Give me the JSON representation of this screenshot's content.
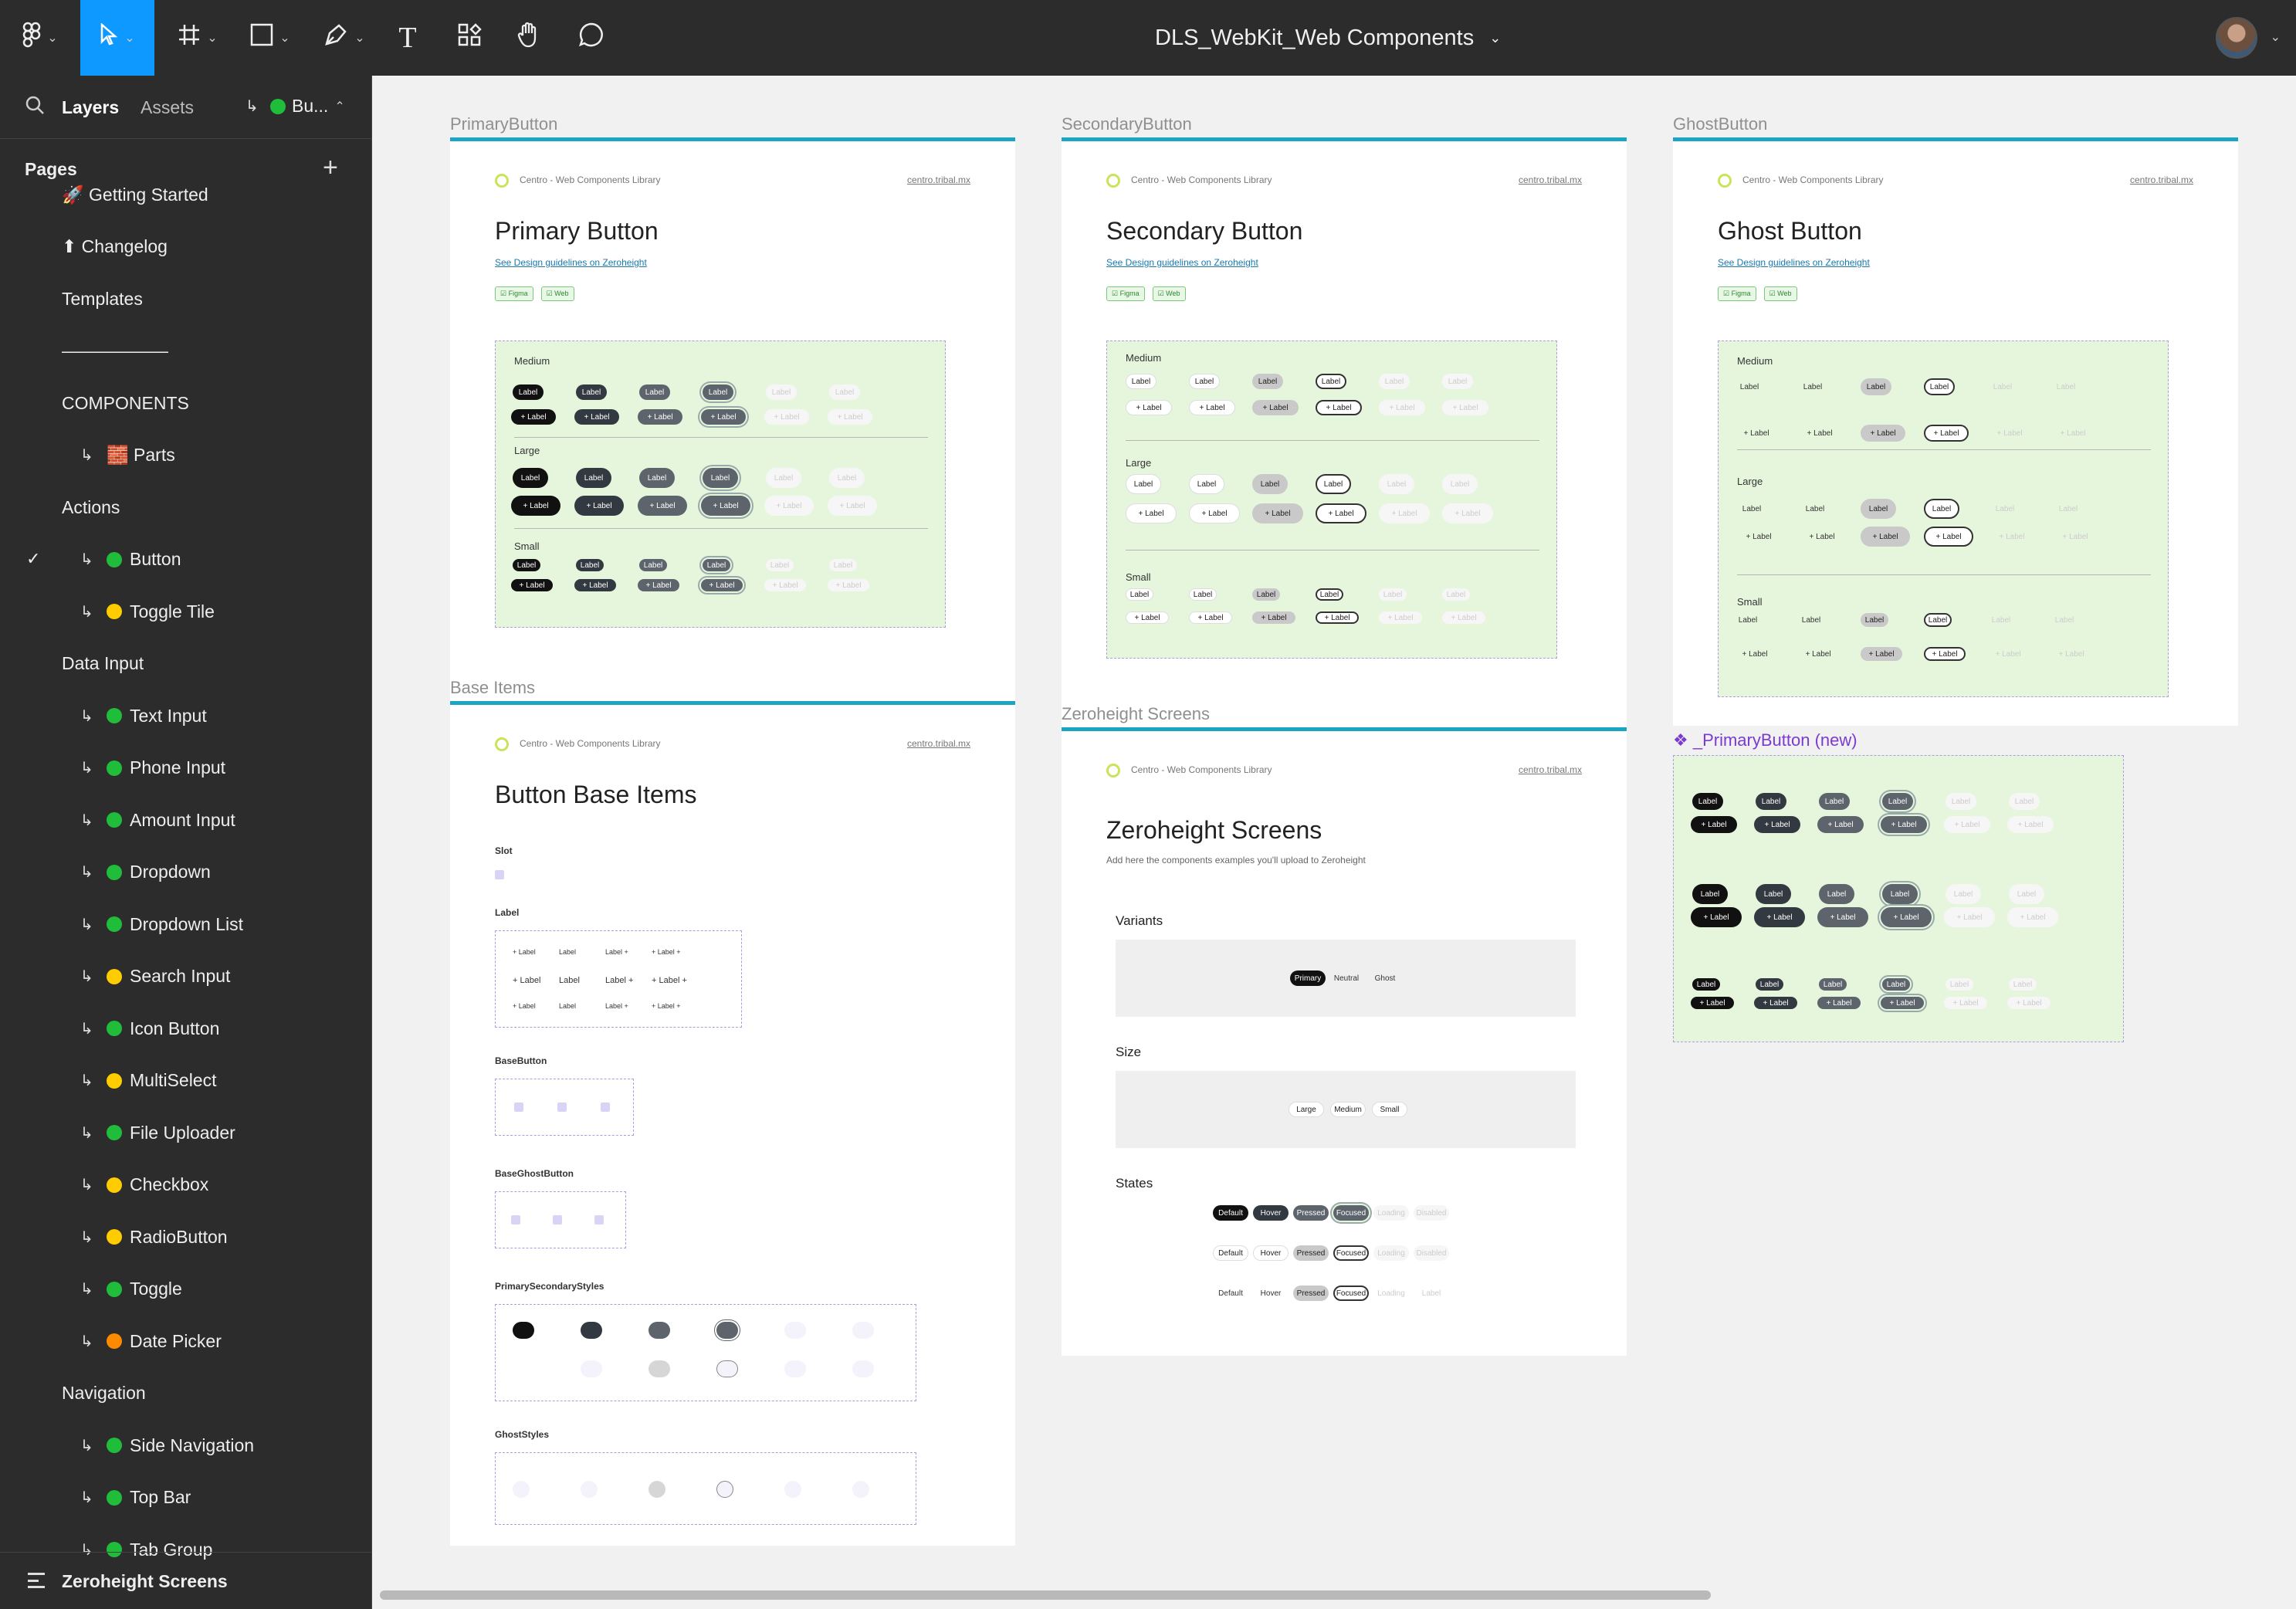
{
  "toolbar": {
    "title": "DLS_WebKit_Web Components",
    "tools": [
      "main-menu",
      "move",
      "frame",
      "shape",
      "pen",
      "text",
      "resources",
      "hand",
      "comment"
    ]
  },
  "sidebar": {
    "tabs": {
      "layers": "Layers",
      "assets": "Assets"
    },
    "current_component": "Bu...",
    "pages_heading": "Pages",
    "pages": [
      {
        "label": "🚀 Getting Started",
        "indent": false,
        "dot": ""
      },
      {
        "label": "⬆ Changelog",
        "indent": false,
        "dot": ""
      },
      {
        "label": "Templates",
        "indent": false,
        "dot": ""
      },
      {
        "label": "——————",
        "indent": false,
        "dot": ""
      },
      {
        "label": "COMPONENTS",
        "indent": false,
        "dot": ""
      },
      {
        "label": "🧱 Parts",
        "indent": true,
        "dot": ""
      },
      {
        "label": "Actions",
        "indent": false,
        "dot": ""
      },
      {
        "label": "Button",
        "indent": true,
        "dot": "g",
        "selected": true
      },
      {
        "label": "Toggle Tile",
        "indent": true,
        "dot": "y"
      },
      {
        "label": "Data Input",
        "indent": false,
        "dot": ""
      },
      {
        "label": "Text Input",
        "indent": true,
        "dot": "g"
      },
      {
        "label": "Phone Input",
        "indent": true,
        "dot": "g"
      },
      {
        "label": "Amount Input",
        "indent": true,
        "dot": "g"
      },
      {
        "label": "Dropdown",
        "indent": true,
        "dot": "g"
      },
      {
        "label": "Dropdown List",
        "indent": true,
        "dot": "g"
      },
      {
        "label": "Search Input",
        "indent": true,
        "dot": "y"
      },
      {
        "label": "Icon Button",
        "indent": true,
        "dot": "g"
      },
      {
        "label": "MultiSelect",
        "indent": true,
        "dot": "y"
      },
      {
        "label": "File Uploader",
        "indent": true,
        "dot": "g"
      },
      {
        "label": "Checkbox",
        "indent": true,
        "dot": "y"
      },
      {
        "label": "RadioButton",
        "indent": true,
        "dot": "y"
      },
      {
        "label": "Toggle",
        "indent": true,
        "dot": "g"
      },
      {
        "label": "Date Picker",
        "indent": true,
        "dot": "o"
      },
      {
        "label": "Navigation",
        "indent": false,
        "dot": ""
      },
      {
        "label": "Side Navigation",
        "indent": true,
        "dot": "g"
      },
      {
        "label": "Top Bar",
        "indent": true,
        "dot": "g"
      },
      {
        "label": "Tab Group",
        "indent": true,
        "dot": "g"
      }
    ],
    "bottom": "Zeroheight Screens"
  },
  "frames": {
    "primary": {
      "label": "PrimaryButton",
      "title": "Primary Button"
    },
    "secondary": {
      "label": "SecondaryButton",
      "title": "Secondary Button"
    },
    "ghost": {
      "label": "GhostButton",
      "title": "Ghost Button"
    },
    "base": {
      "label": "Base Items",
      "title": "Button Base Items"
    },
    "zero": {
      "label": "Zeroheight Screens",
      "title": "Zeroheight Screens",
      "subtitle": "Add here the components examples you'll upload to Zeroheight"
    },
    "newbtn": {
      "label": "❖ _PrimaryButton (new)"
    }
  },
  "common": {
    "lib": "Centro - Web Components Library",
    "link": "centro.tribal.mx",
    "guide": "See Design guidelines on Zeroheight",
    "tag_figma": "Figma",
    "tag_web": "Web",
    "btn": "Label",
    "btn_plus": "+ Label"
  },
  "sizes": {
    "medium": "Medium",
    "large": "Large",
    "small": "Small"
  },
  "base_sections": {
    "slot": "Slot",
    "label": "Label",
    "base": "BaseButton",
    "ghostbase": "BaseGhostButton",
    "ps": "PrimarySecondaryStyles",
    "gs": "GhostStyles"
  },
  "zero_sections": {
    "variants": "Variants",
    "size": "Size",
    "states": "States",
    "variant_items": [
      "Primary",
      "Neutral",
      "Ghost"
    ],
    "size_items": [
      "Large",
      "Medium",
      "Small"
    ],
    "state_items": [
      "Default",
      "Hover",
      "Pressed",
      "Focused",
      "Loading",
      "Disabled"
    ],
    "state_items_last": [
      "Default",
      "Hover",
      "Pressed",
      "Focused",
      "Loading",
      "Label"
    ]
  }
}
